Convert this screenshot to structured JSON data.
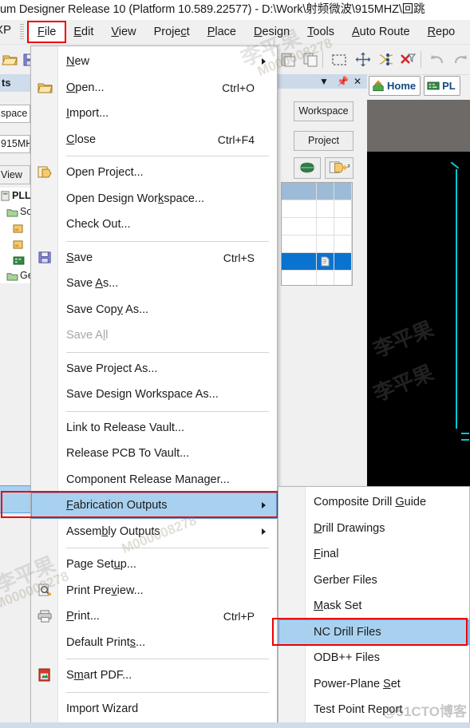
{
  "window": {
    "title": "um Designer Release 10 (Platform 10.589.22577) - D:\\Work\\射频微波\\915MHZ\\回跳"
  },
  "menubar": {
    "xp_label": "XP",
    "items": [
      {
        "label": "File",
        "mnemonic": "F",
        "active": true
      },
      {
        "label": "Edit",
        "mnemonic": "E",
        "active": false
      },
      {
        "label": "View",
        "mnemonic": "V",
        "active": false
      },
      {
        "label": "Project",
        "mnemonic": "c",
        "active": false
      },
      {
        "label": "Place",
        "mnemonic": "P",
        "active": false
      },
      {
        "label": "Design",
        "mnemonic": "D",
        "active": false
      },
      {
        "label": "Tools",
        "mnemonic": "T",
        "active": false
      },
      {
        "label": "Auto Route",
        "mnemonic": "A",
        "active": false
      },
      {
        "label": "Repo",
        "mnemonic": "R",
        "active": false
      }
    ]
  },
  "toolbar": {
    "icons": [
      "open-folder-icon",
      "save-icon",
      "paste-icon",
      "copy-icon",
      "select-area-icon",
      "move-icon",
      "shuffle-icon",
      "clear-filter-icon",
      "undo-icon",
      "redo-icon"
    ]
  },
  "left_panel": {
    "header": "ts",
    "combo_workspace": "space",
    "combo_project": "915MH",
    "view_button": "View",
    "tree": [
      {
        "label": "PLL",
        "icon": "project-icon",
        "bold": true
      },
      {
        "label": "So",
        "icon": "folder-icon",
        "bold": false
      },
      {
        "label": "",
        "icon": "schematic-doc-icon",
        "bold": false
      },
      {
        "label": "",
        "icon": "schematic-doc-icon",
        "bold": false
      },
      {
        "label": "",
        "icon": "pcb-doc-icon",
        "bold": false
      },
      {
        "label": "Ge",
        "icon": "folder-icon",
        "bold": false
      }
    ]
  },
  "doc_panel": {
    "caption_buttons": [
      "chevron-down-icon",
      "pin-icon",
      "close-icon"
    ],
    "workspace_button": "Workspace",
    "project_button": "Project",
    "globe_button": "globe-icon",
    "open-doc_button": "open-document-icon"
  },
  "view_tabs": [
    {
      "label": "Home",
      "icon": "home-icon"
    },
    {
      "label": "PL",
      "icon": "pcb-icon"
    }
  ],
  "file_menu": {
    "items": [
      {
        "label": "New",
        "mnemonic": "N",
        "accel": "",
        "submenu": true,
        "icon": "",
        "disabled": false,
        "sep_after": false
      },
      {
        "label": "Open...",
        "mnemonic": "O",
        "accel": "Ctrl+O",
        "submenu": false,
        "icon": "open-folder-icon",
        "disabled": false,
        "sep_after": false
      },
      {
        "label": "Import...",
        "mnemonic": "I",
        "accel": "",
        "submenu": false,
        "icon": "",
        "disabled": false,
        "sep_after": false
      },
      {
        "label": "Close",
        "mnemonic": "C",
        "accel": "Ctrl+F4",
        "submenu": false,
        "icon": "",
        "disabled": false,
        "sep_after": true
      },
      {
        "label": "Open Project...",
        "mnemonic": "",
        "accel": "",
        "submenu": false,
        "icon": "open-project-icon",
        "disabled": false,
        "sep_after": false
      },
      {
        "label": "Open Design Workspace...",
        "mnemonic": "k",
        "accel": "",
        "submenu": false,
        "icon": "",
        "disabled": false,
        "sep_after": false
      },
      {
        "label": "Check Out...",
        "mnemonic": "",
        "accel": "",
        "submenu": false,
        "icon": "",
        "disabled": false,
        "sep_after": true
      },
      {
        "label": "Save",
        "mnemonic": "S",
        "accel": "Ctrl+S",
        "submenu": false,
        "icon": "save-icon",
        "disabled": false,
        "sep_after": false
      },
      {
        "label": "Save As...",
        "mnemonic": "A",
        "accel": "",
        "submenu": false,
        "icon": "",
        "disabled": false,
        "sep_after": false
      },
      {
        "label": "Save Copy As...",
        "mnemonic": "y",
        "accel": "",
        "submenu": false,
        "icon": "",
        "disabled": false,
        "sep_after": false
      },
      {
        "label": "Save All",
        "mnemonic": "l",
        "accel": "",
        "submenu": false,
        "icon": "",
        "disabled": true,
        "sep_after": true
      },
      {
        "label": "Save Project As...",
        "mnemonic": "",
        "accel": "",
        "submenu": false,
        "icon": "",
        "disabled": false,
        "sep_after": false
      },
      {
        "label": "Save Design Workspace As...",
        "mnemonic": "g",
        "accel": "",
        "submenu": false,
        "icon": "",
        "disabled": false,
        "sep_after": true
      },
      {
        "label": "Link to Release Vault...",
        "mnemonic": "",
        "accel": "",
        "submenu": false,
        "icon": "",
        "disabled": false,
        "sep_after": false
      },
      {
        "label": "Release PCB To Vault...",
        "mnemonic": "",
        "accel": "",
        "submenu": false,
        "icon": "",
        "disabled": false,
        "sep_after": false
      },
      {
        "label": "Component Release Manager...",
        "mnemonic": "",
        "accel": "",
        "submenu": false,
        "icon": "",
        "disabled": false,
        "sep_after": false
      },
      {
        "label": "Fabrication Outputs",
        "mnemonic": "F",
        "accel": "",
        "submenu": true,
        "icon": "",
        "disabled": false,
        "sep_after": false,
        "highlighted": true,
        "outlined": true
      },
      {
        "label": "Assembly Outputs",
        "mnemonic": "b",
        "accel": "",
        "submenu": true,
        "icon": "",
        "disabled": false,
        "sep_after": true
      },
      {
        "label": "Page Setup...",
        "mnemonic": "u",
        "accel": "",
        "submenu": false,
        "icon": "",
        "disabled": false,
        "sep_after": false
      },
      {
        "label": "Print Preview...",
        "mnemonic": "v",
        "accel": "",
        "submenu": false,
        "icon": "print-preview-icon",
        "disabled": false,
        "sep_after": false
      },
      {
        "label": "Print...",
        "mnemonic": "P",
        "accel": "Ctrl+P",
        "submenu": false,
        "icon": "printer-icon",
        "disabled": false,
        "sep_after": false
      },
      {
        "label": "Default Prints...",
        "mnemonic": "s",
        "accel": "",
        "submenu": false,
        "icon": "",
        "disabled": false,
        "sep_after": true
      },
      {
        "label": "Smart PDF...",
        "mnemonic": "m",
        "accel": "",
        "submenu": false,
        "icon": "pdf-icon",
        "disabled": false,
        "sep_after": true
      },
      {
        "label": "Import Wizard",
        "mnemonic": "",
        "accel": "",
        "submenu": false,
        "icon": "",
        "disabled": false,
        "sep_after": true
      }
    ]
  },
  "fabrication_submenu": {
    "items": [
      {
        "label": "Composite Drill Guide",
        "mnemonic": "G",
        "highlighted": false
      },
      {
        "label": "Drill Drawings",
        "mnemonic": "D",
        "highlighted": false
      },
      {
        "label": "Final",
        "mnemonic": "F",
        "highlighted": false
      },
      {
        "label": "Gerber Files",
        "mnemonic": "",
        "highlighted": false
      },
      {
        "label": "Mask Set",
        "mnemonic": "M",
        "highlighted": false
      },
      {
        "label": "NC Drill Files",
        "mnemonic": "",
        "highlighted": true,
        "outlined": true
      },
      {
        "label": "ODB++ Files",
        "mnemonic": "",
        "highlighted": false
      },
      {
        "label": "Power-Plane Set",
        "mnemonic": "S",
        "highlighted": false
      },
      {
        "label": "Test Point Report",
        "mnemonic": "",
        "highlighted": false
      }
    ]
  },
  "watermarks": {
    "name": "李平果",
    "number": "M000008278",
    "corner": "@51CTO博客"
  },
  "colors": {
    "accent_highlight": "#a8d1f0",
    "outline_red": "#ee0000",
    "caption_blue": "#cfdceb",
    "selected_blue": "#0a73d0",
    "pcb_cyan": "#00c8d7",
    "canvas_black": "#000000",
    "canvas_grey": "#6e6a68"
  }
}
